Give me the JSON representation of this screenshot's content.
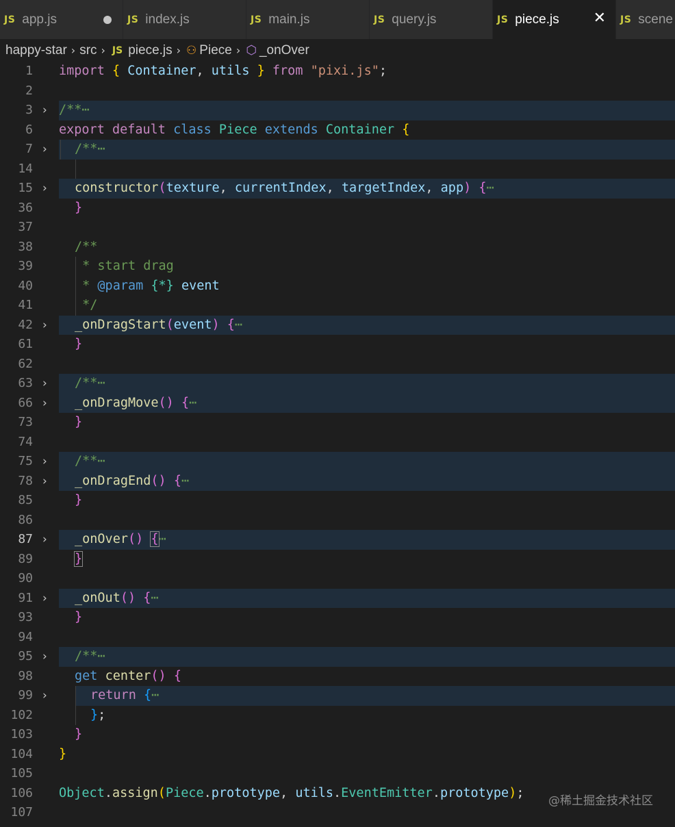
{
  "tabs": [
    {
      "label": "app.js",
      "icon": "JS",
      "state": "modified"
    },
    {
      "label": "index.js",
      "icon": "JS",
      "state": ""
    },
    {
      "label": "main.js",
      "icon": "JS",
      "state": ""
    },
    {
      "label": "query.js",
      "icon": "JS",
      "state": ""
    },
    {
      "label": "piece.js",
      "icon": "JS",
      "state": "active",
      "close": "✕"
    },
    {
      "label": "scene",
      "icon": "JS",
      "state": ""
    }
  ],
  "breadcrumb": {
    "folder": "happy-star",
    "src": "src",
    "file": "piece.js",
    "file_icon": "JS",
    "class": "Piece",
    "method": "_onOver"
  },
  "gutter": [
    "1",
    "2",
    "3",
    "6",
    "7",
    "14",
    "15",
    "36",
    "37",
    "38",
    "39",
    "40",
    "41",
    "42",
    "61",
    "62",
    "63",
    "66",
    "73",
    "74",
    "75",
    "78",
    "85",
    "86",
    "87",
    "89",
    "90",
    "91",
    "93",
    "94",
    "95",
    "98",
    "99",
    "102",
    "103",
    "104",
    "105",
    "106",
    "107"
  ],
  "code": {
    "imp_import": "import",
    "imp_container": "Container",
    "imp_utils": "utils",
    "imp_from": "from",
    "imp_pixi": "\"pixi.js\"",
    "doc_fold": "/**",
    "ellipsis": "⋯",
    "exp_export": "export",
    "exp_default": "default",
    "exp_class": "class",
    "exp_piece": "Piece",
    "exp_extends": "extends",
    "exp_container": "Container",
    "ctor_name": "constructor",
    "ctor_texture": "texture",
    "ctor_current": "currentIndex",
    "ctor_target": "targetIndex",
    "ctor_app": "app",
    "cm_open": "/**",
    "cm_start": " * start drag",
    "cm_star": " *",
    "cm_param": "@param",
    "cm_type": "{*}",
    "cm_event": "event",
    "cm_close": " */",
    "m_drag_start": "_onDragStart",
    "m_drag_start_arg": "event",
    "m_drag_move": "_onDragMove",
    "m_drag_end": "_onDragEnd",
    "m_over": "_onOver",
    "m_out": "_onOut",
    "get_kw": "get",
    "get_center": "center",
    "ret_kw": "return",
    "obj": "Object",
    "assign": "assign",
    "proto_piece": "Piece",
    "prototype": "prototype",
    "utils": "utils",
    "emitter": "EventEmitter"
  },
  "watermark": "@稀土掘金技术社区"
}
